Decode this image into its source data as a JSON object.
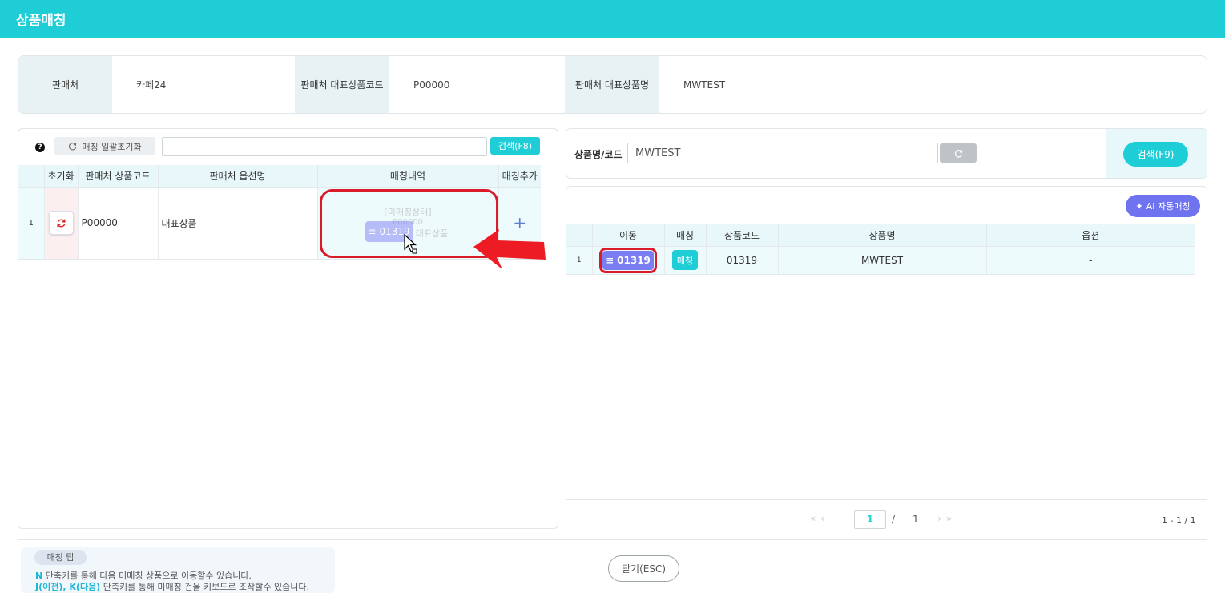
{
  "window": {
    "title": "상품매칭"
  },
  "info": {
    "seller_label": "판매처",
    "seller_value": "카페24",
    "code_label": "판매처 대표상품코드",
    "code_value": "P00000",
    "name_label": "판매처 대표상품명",
    "name_value": "MWTEST"
  },
  "left": {
    "reset_all_label": "매칭 일괄초기화",
    "search_value": "",
    "search_button": "검색(F8)",
    "columns": [
      "초기화",
      "판매처 상품코드",
      "판매처 옵션명",
      "매칭내역",
      "매칭추가"
    ],
    "rows": [
      {
        "no": "1",
        "code": "P00000",
        "option": "대표상품",
        "match_status": "[미매칭상태]",
        "match_code": "P00000",
        "match_name": "대표상품",
        "drag_chip": "01319"
      }
    ],
    "add_symbol": "+"
  },
  "right": {
    "search_label": "상품명/코드",
    "search_value": "MWTEST",
    "search_button": "검색(F9)",
    "ai_button": "AI 자동매칭",
    "columns": [
      "이동",
      "매칭",
      "상품코드",
      "상품명",
      "옵션"
    ],
    "rows": [
      {
        "no": "1",
        "move_chip": "01319",
        "match_button": "매칭",
        "code": "01319",
        "name": "MWTEST",
        "option": "-"
      }
    ],
    "pager": {
      "current": "1",
      "separator": "/",
      "total": "1",
      "range": "1 - 1 / 1"
    }
  },
  "tips": {
    "title": "매칭 팁",
    "line1_key": "N",
    "line1_text": " 단축키를 통해 다음 미매칭 상품으로 이동할수 있습니다.",
    "line2_key": "J(이전), K(다음)",
    "line2_text": " 단축키를 통해 미매칭 건을 키보드로 조작할수 있습니다."
  },
  "close_button": "닫기(ESC)",
  "colors": {
    "accent": "#1ecdd6",
    "chip": "#7b7ef2",
    "highlight": "#d91b2a"
  }
}
